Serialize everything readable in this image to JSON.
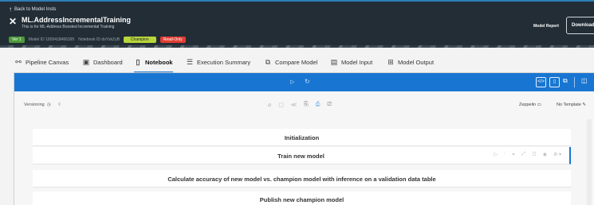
{
  "header": {
    "back_label": "Back to Model Insts",
    "model_name": "ML.AddressIncrementalTraining",
    "description": "This is for ML-Address Boosted Incremental Training",
    "version_badge": "Ver 1",
    "model_id": "Model ID 1659418466395",
    "notebook_id": "Notebook ID dsYskZyB",
    "champion_badge": "Champion",
    "readonly_badge": "Read-Only",
    "model_report": "Model Report",
    "download": "Download"
  },
  "tabs": [
    {
      "label": "Pipeline Canvas",
      "icon": "pipeline-icon"
    },
    {
      "label": "Dashboard",
      "icon": "dashboard-icon"
    },
    {
      "label": "Notebook",
      "icon": "notebook-icon",
      "active": true
    },
    {
      "label": "Execution Summary",
      "icon": "list-icon"
    },
    {
      "label": "Compare Model",
      "icon": "compare-icon"
    },
    {
      "label": "Model Input",
      "icon": "input-icon"
    },
    {
      "label": "Model Output",
      "icon": "output-icon"
    }
  ],
  "notebook": {
    "versioning": "Versioning",
    "interpreter": "Zeppelin",
    "template": "No Template",
    "paragraphs": [
      "Initialization",
      "Train new model",
      "Calculate accuracy of new model vs. champion model with inference on a validation data table",
      "Publish new champion model"
    ]
  },
  "colors": {
    "header_bg": "#222d36",
    "toolbar_blue": "#1876d2",
    "badge_green": "#4c9a3b",
    "badge_champion": "#b8d63a",
    "badge_readonly": "#e23d32"
  }
}
